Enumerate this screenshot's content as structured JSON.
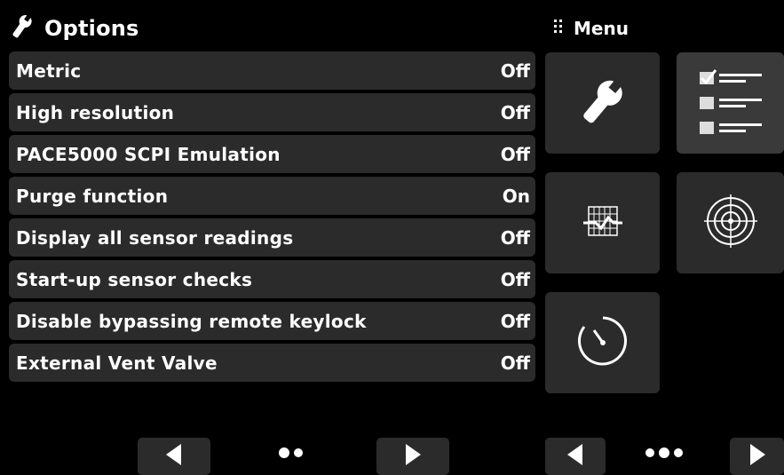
{
  "header": {
    "title": "Options",
    "title_icon": "wrench-icon"
  },
  "menu": {
    "title": "Menu",
    "icon": "grip-dots-icon",
    "tiles": [
      {
        "name": "settings-wrench-tile",
        "icon": "wrench-icon"
      },
      {
        "name": "options-list-tile",
        "icon": "checklist-icon",
        "active": true
      },
      {
        "name": "chart-tile",
        "icon": "chart-graph-icon"
      },
      {
        "name": "target-tile",
        "icon": "target-icon"
      },
      {
        "name": "timer-tile",
        "icon": "stopwatch-icon"
      }
    ]
  },
  "options": [
    {
      "label": "Metric",
      "value": "Off"
    },
    {
      "label": "High resolution",
      "value": "Off"
    },
    {
      "label": "PACE5000 SCPI Emulation",
      "value": "Off"
    },
    {
      "label": "Purge function",
      "value": "On"
    },
    {
      "label": "Display all sensor readings",
      "value": "Off"
    },
    {
      "label": "Start-up sensor checks",
      "value": "Off"
    },
    {
      "label": "Disable bypassing remote keylock",
      "value": "Off"
    },
    {
      "label": "External Vent Valve",
      "value": "Off"
    }
  ],
  "pager_left": {
    "pages": 2
  },
  "pager_right": {
    "pages": 3
  },
  "colors": {
    "background": "#000000",
    "row": "#2b2b2b",
    "text": "#ffffff"
  }
}
